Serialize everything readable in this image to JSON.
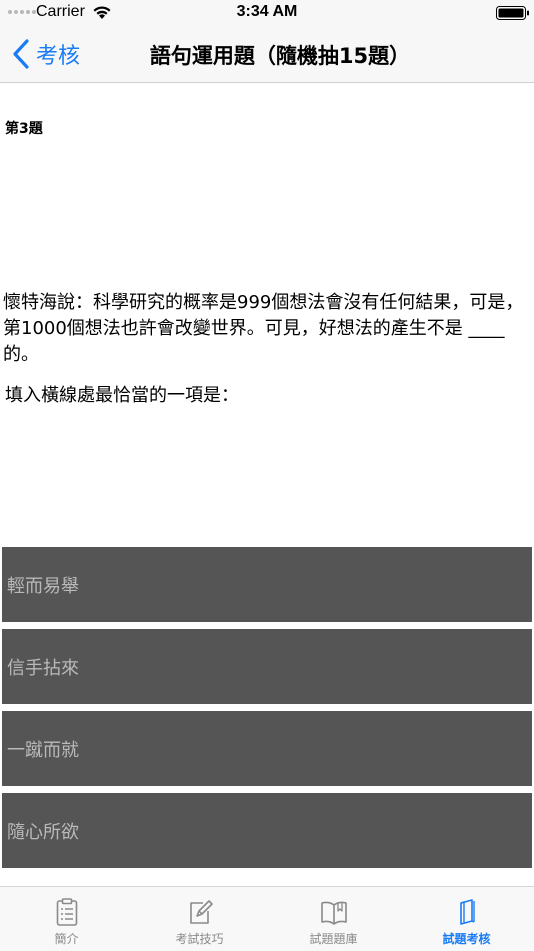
{
  "status_bar": {
    "carrier": "Carrier",
    "time": "3:34 AM"
  },
  "nav": {
    "back_label": "考核",
    "title": "語句運用題（隨機抽15題）"
  },
  "question": {
    "number": "第3題",
    "text": "懷特海說：科學研究的概率是999個想法會沒有任何結果，可是，第1000個想法也許會改變世界。可見，好想法的產生不是 ____ 的。",
    "instruction": " 填入橫線處最恰當的一項是："
  },
  "options": [
    {
      "label": "輕而易舉"
    },
    {
      "label": "信手拈來"
    },
    {
      "label": "一蹴而就"
    },
    {
      "label": "隨心所欲"
    }
  ],
  "tabs": [
    {
      "label": "簡介",
      "icon": "clipboard-icon"
    },
    {
      "label": "考試技巧",
      "icon": "edit-icon"
    },
    {
      "label": "試題題庫",
      "icon": "book-icon"
    },
    {
      "label": "試題考核",
      "icon": "booklet-icon"
    }
  ],
  "colors": {
    "accent": "#1a7cf5",
    "option_background": "#555555",
    "option_text": "#b9b9b9"
  }
}
